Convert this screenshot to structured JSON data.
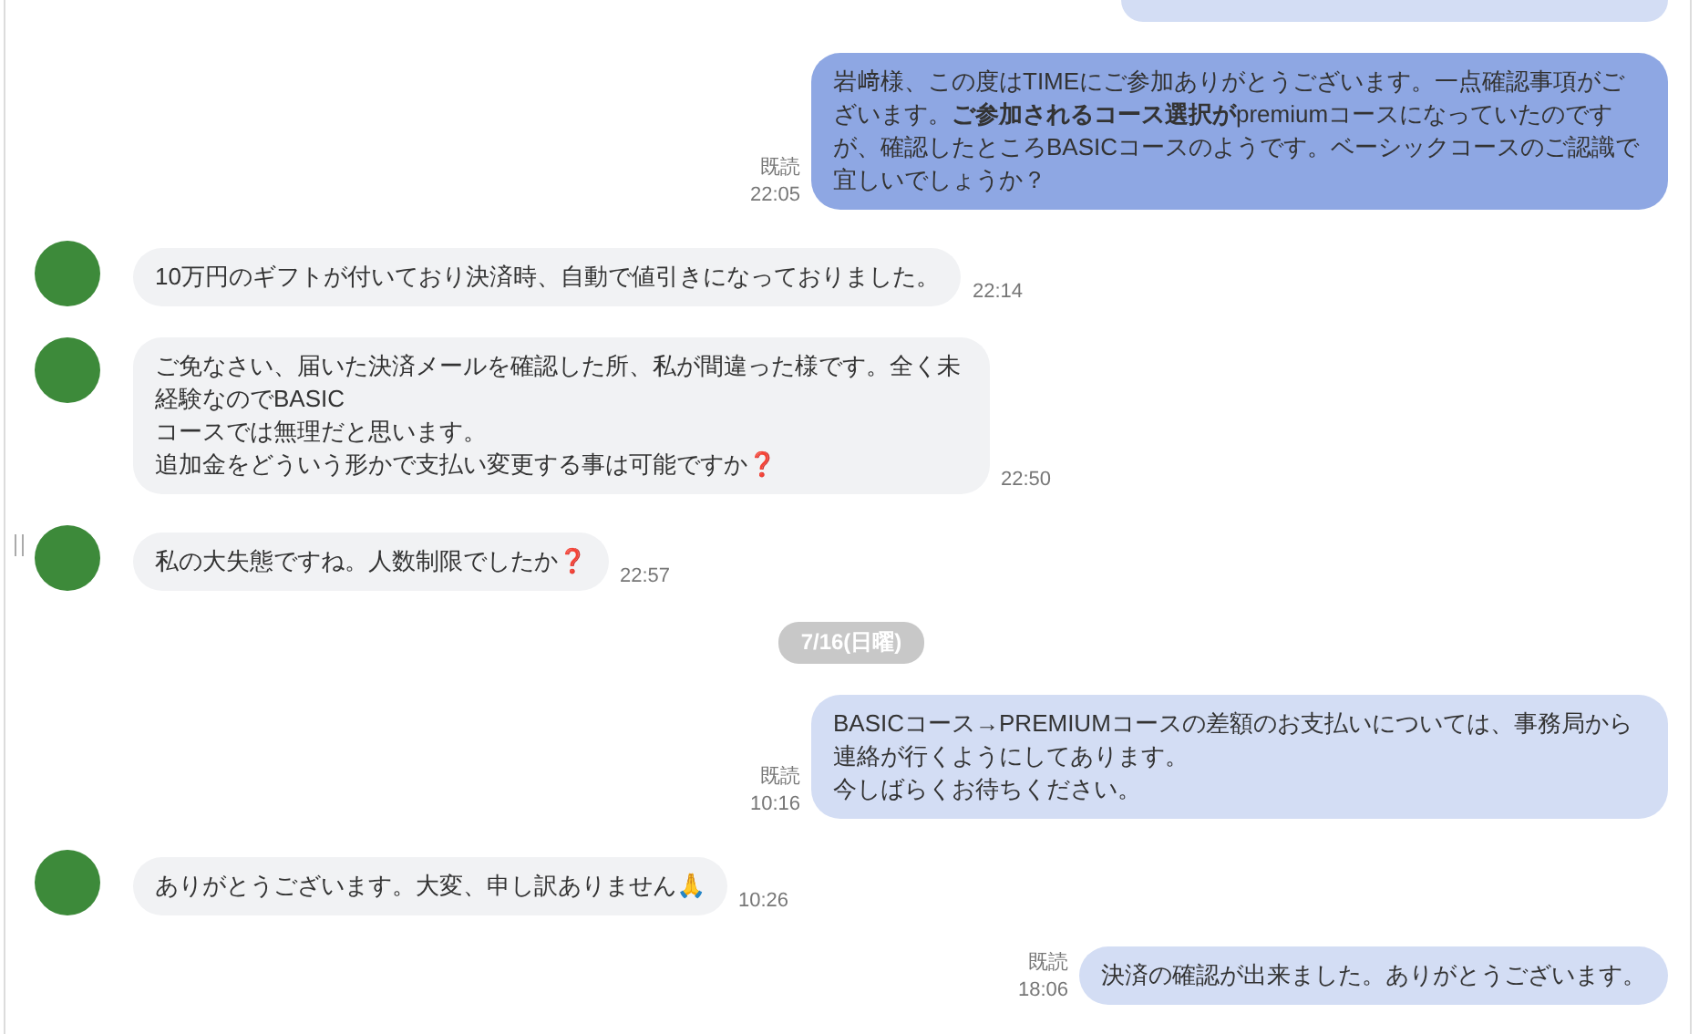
{
  "messages": [
    {
      "kind": "sent",
      "lines": [
        "岩﨑様、この度はTIMEにご参加ありがとうございます。一点確認事項がございます。**ご参加されるコース選択が**premiumコースになっていたのですが、確認したところBASICコースのようです。ベーシックコースのご認識で宜しいでしょうか？"
      ],
      "read": "既読",
      "time": "22:05",
      "highlighted": true
    },
    {
      "kind": "received",
      "lines": [
        "10万円のギフトが付いており決済時、自動で値引きになっておりました。"
      ],
      "time": "22:14"
    },
    {
      "kind": "received",
      "lines": [
        "ご免なさい、届いた決済メールを確認した所、私が間違った様です。全く未経験なのでBASIC",
        "コースでは無理だと思います。",
        "追加金をどういう形かで支払い変更する事は可能ですか❓"
      ],
      "time": "22:50"
    },
    {
      "kind": "received",
      "lines": [
        "私の大失態ですね。人数制限でしたか❓"
      ],
      "time": "22:57"
    },
    {
      "kind": "date",
      "text": "7/16(日曜)"
    },
    {
      "kind": "sent",
      "lines": [
        "BASICコース→PREMIUMコースの差額のお支払いについては、事務局から連絡が行くようにしてあります。",
        "今しばらくお待ちください。"
      ],
      "read": "既読",
      "time": "10:16",
      "highlighted": false
    },
    {
      "kind": "received",
      "lines": [
        "ありがとうございます。大変、申し訳ありません🙏"
      ],
      "time": "10:26"
    },
    {
      "kind": "sent",
      "lines": [
        "決済の確認が出来ました。ありがとうございます。"
      ],
      "read": "既読",
      "time": "18:06",
      "highlighted": false
    }
  ]
}
